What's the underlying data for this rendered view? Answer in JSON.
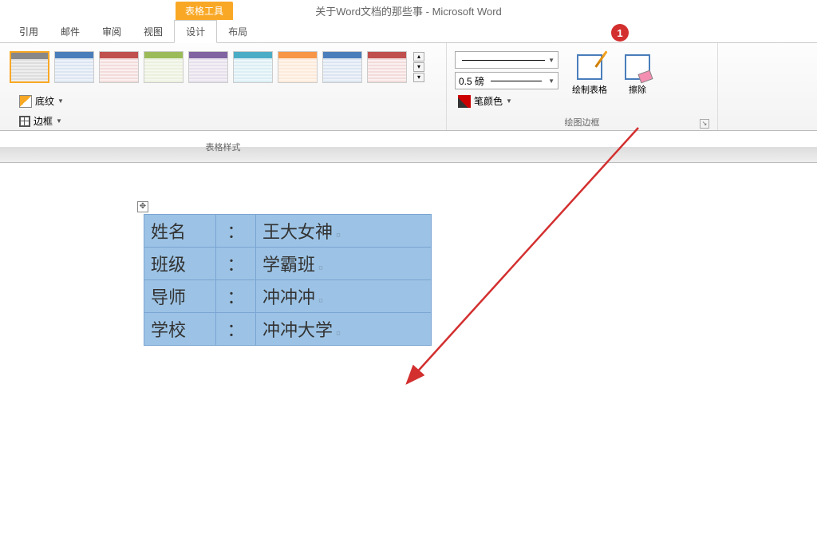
{
  "window": {
    "title": "关于Word文档的那些事 - Microsoft Word",
    "contextual_tab_group": "表格工具"
  },
  "tabs": {
    "references": "引用",
    "mailings": "邮件",
    "review": "审阅",
    "view": "视图",
    "design": "设计",
    "layout": "布局"
  },
  "ribbon": {
    "styles_group_label": "表格样式",
    "borders_group_label": "绘图边框",
    "shading_label": "底纹",
    "borders_label": "边框",
    "pen_color_label": "笔颜色",
    "line_weight_value": "0.5 磅",
    "draw_table_label": "绘制表格",
    "eraser_label": "擦除"
  },
  "annotation": {
    "badge_number": "1"
  },
  "doc_table": {
    "anchor_symbol": "✥",
    "rows": [
      {
        "label": "姓名",
        "sep": "：",
        "value": "王大女神"
      },
      {
        "label": "班级",
        "sep": "：",
        "value": "学霸班"
      },
      {
        "label": "导师",
        "sep": "：",
        "value": "冲冲冲"
      },
      {
        "label": "学校",
        "sep": "：",
        "value": "冲冲大学"
      }
    ]
  }
}
